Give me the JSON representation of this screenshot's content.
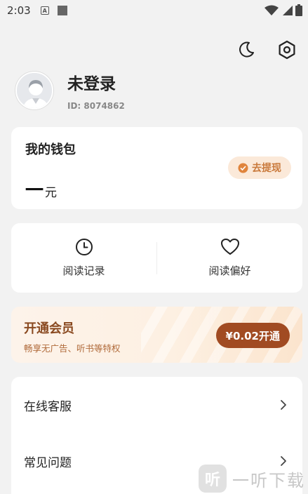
{
  "status_bar": {
    "time": "2:03",
    "notification_letter": "A"
  },
  "profile": {
    "username": "未登录",
    "user_id": "ID: 8074862"
  },
  "wallet": {
    "title": "我的钱包",
    "amount": "一",
    "unit": "元",
    "withdraw_label": "去提现"
  },
  "quick_actions": [
    {
      "label": "阅读记录",
      "icon": "clock-icon"
    },
    {
      "label": "阅读偏好",
      "icon": "heart-icon"
    }
  ],
  "vip": {
    "title": "开通会员",
    "subtitle": "畅享无广告、听书等特权",
    "button_label": "¥0.02开通"
  },
  "menu": [
    {
      "label": "在线客服"
    },
    {
      "label": "常见问题"
    }
  ],
  "watermark": {
    "logo_char": "听",
    "text": "一听下载"
  },
  "colors": {
    "background": "#f2f2f2",
    "card": "#ffffff",
    "vip_button": "#a14b22",
    "withdraw_text": "#c9793b",
    "vip_title": "#8a4a21"
  }
}
